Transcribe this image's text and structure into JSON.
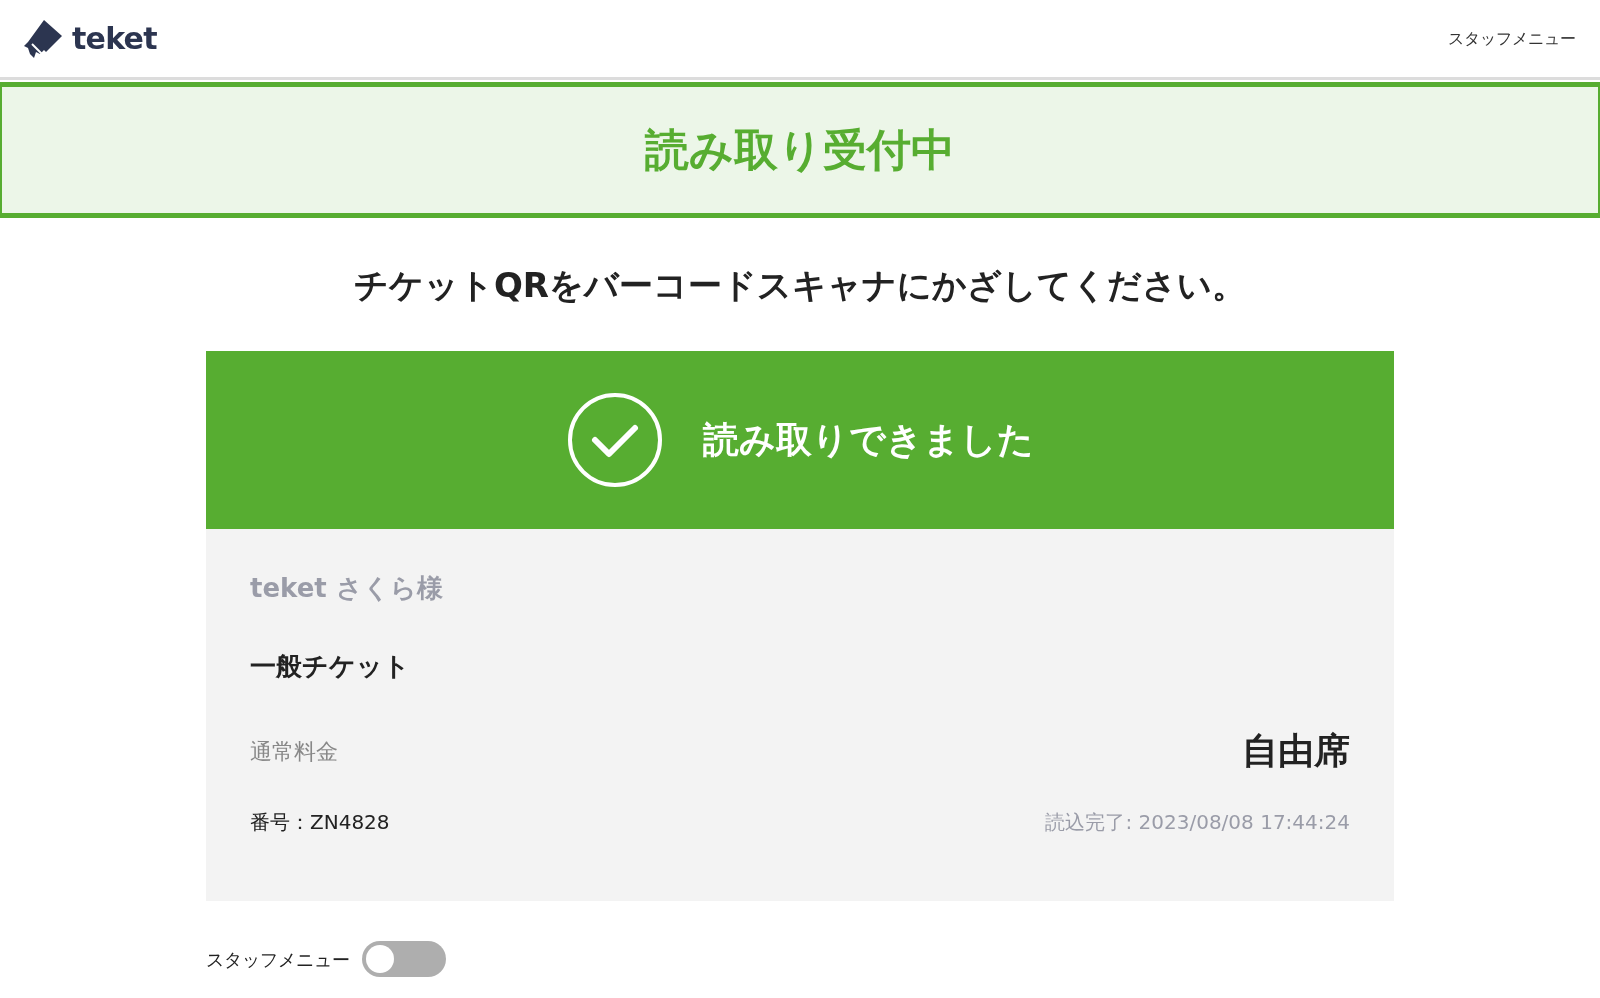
{
  "header": {
    "logo_text": "teket",
    "menu_link": "スタッフメニュー"
  },
  "status_banner": {
    "text": "読み取り受付中"
  },
  "instruction": "チケットQRをバーコードスキャナにかざしてください。",
  "result": {
    "message": "読み取りできました",
    "holder": "teket さくら様",
    "ticket_type": "一般チケット",
    "price_type": "通常料金",
    "seat": "自由席",
    "number": "番号：ZN4828",
    "read_time": "読込完了: 2023/08/08 17:44:24"
  },
  "staff_toggle": {
    "label": "スタッフメニュー",
    "on": false
  }
}
